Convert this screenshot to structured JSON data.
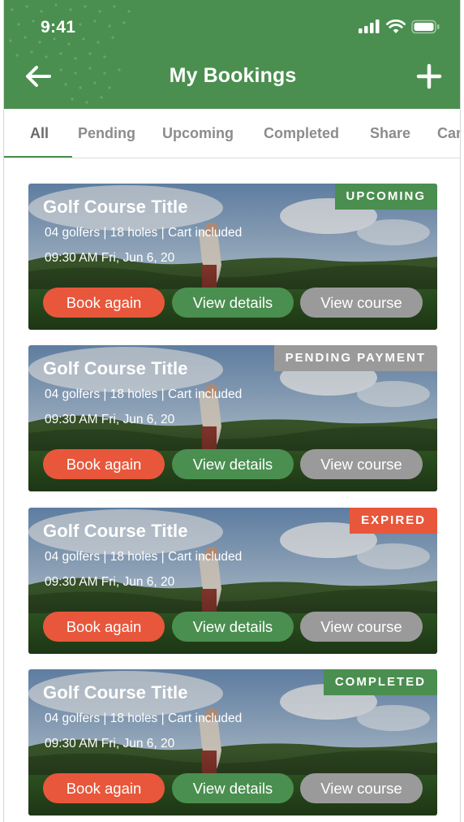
{
  "status_bar": {
    "time": "9:41"
  },
  "header": {
    "title": "My Bookings"
  },
  "tabs": [
    {
      "label": "All",
      "active": true
    },
    {
      "label": "Pending"
    },
    {
      "label": "Upcoming"
    },
    {
      "label": "Completed"
    },
    {
      "label": "Share"
    },
    {
      "label": "Cancelled"
    }
  ],
  "colors": {
    "brand_green": "#4a8f4f",
    "book_red": "#e8573b",
    "course_gray": "#9a9a9a",
    "badge_upcoming": "#4a8f4f",
    "badge_pending": "#9a9a9a",
    "badge_expired": "#e8573b",
    "badge_completed": "#4a8f4f"
  },
  "bookings": [
    {
      "title": "Golf Course Title",
      "details": "04 golfers | 18 holes | Cart included",
      "datetime": "09:30 AM Fri, Jun 6, 20",
      "status": "UPCOMING",
      "actions": {
        "book_again": "Book again",
        "view_details": "View details",
        "view_course": "View course"
      }
    },
    {
      "title": "Golf Course Title",
      "details": "04 golfers | 18 holes | Cart included",
      "datetime": "09:30 AM Fri, Jun 6, 20",
      "status": "PENDING PAYMENT",
      "actions": {
        "book_again": "Book again",
        "view_details": "View details",
        "view_course": "View course"
      }
    },
    {
      "title": "Golf Course Title",
      "details": "04 golfers | 18 holes | Cart included",
      "datetime": "09:30 AM Fri, Jun 6, 20",
      "status": "EXPIRED",
      "actions": {
        "book_again": "Book again",
        "view_details": "View details",
        "view_course": "View course"
      }
    },
    {
      "title": "Golf Course Title",
      "details": "04 golfers | 18 holes | Cart included",
      "datetime": "09:30 AM Fri, Jun 6, 20",
      "status": "COMPLETED",
      "actions": {
        "book_again": "Book again",
        "view_details": "View details",
        "view_course": "View course"
      }
    }
  ]
}
